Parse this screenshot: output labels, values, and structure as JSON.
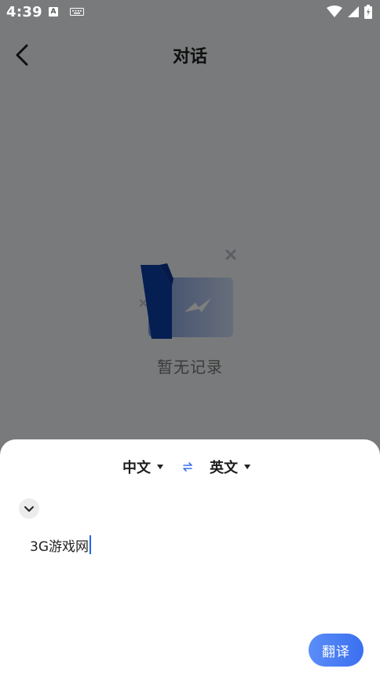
{
  "status_bar": {
    "time": "4:39",
    "notification_badge": "A"
  },
  "header": {
    "title": "对话"
  },
  "empty_state": {
    "text": "暂无记录"
  },
  "sheet": {
    "source_language": "中文",
    "target_language": "英文",
    "input_value": "3G游戏网",
    "translate_label": "翻译"
  },
  "colors": {
    "accent": "#3a6ff0",
    "cursor": "#1f66e5",
    "illustration_blue": "#0b3fa6"
  }
}
